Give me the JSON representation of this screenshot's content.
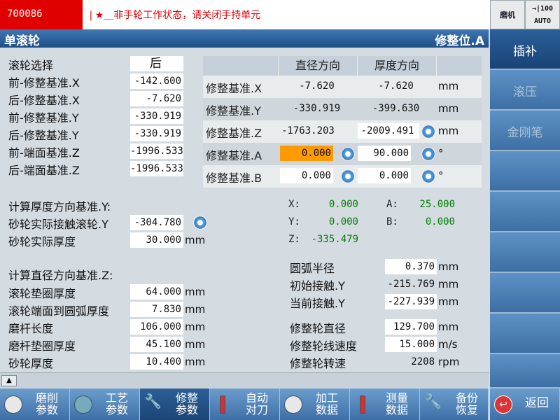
{
  "alarm": {
    "id": "700086",
    "message": "❘★＿非手轮工作状态，请关闭手持单元"
  },
  "mode": {
    "icon_text": "磨机",
    "feed": "→|100",
    "op_mode": "AUTO"
  },
  "title": {
    "left": "单滚轮",
    "right": "修整位.A"
  },
  "left_params": [
    {
      "label": "滚轮选择",
      "value": "后"
    },
    {
      "label": "前-修整基准.X",
      "value": "-142.600"
    },
    {
      "label": "后-修整基准.X",
      "value": "-7.620"
    },
    {
      "label": "前-修整基准.Y",
      "value": "-330.919"
    },
    {
      "label": "后-修整基准.Y",
      "value": "-330.919"
    },
    {
      "label": "前-端面基准.Z",
      "value": "-1996.533"
    },
    {
      "label": "后-端面基准.Z",
      "value": "-1996.533"
    }
  ],
  "table": {
    "headers": [
      "直径方向",
      "厚度方向"
    ],
    "rows": [
      {
        "label": "修整基准.X",
        "dia": "-7.620",
        "thk": "-7.620",
        "unit": "mm"
      },
      {
        "label": "修整基准.Y",
        "dia": "-330.919",
        "thk": "-399.630",
        "unit": "mm"
      },
      {
        "label": "修整基准.Z",
        "dia": "-1763.203",
        "thk": "-2009.491",
        "unit": "mm"
      },
      {
        "label": "修整基准.A",
        "dia": "0.000",
        "thk": "90.000",
        "unit": "°"
      },
      {
        "label": "修整基准.B",
        "dia": "0.000",
        "thk": "0.000",
        "unit": "°"
      }
    ]
  },
  "thickness_section": {
    "title": "计算厚度方向基准.Y:",
    "contact_label": "砂轮实际接触滚轮.Y",
    "contact_value": "-304.780",
    "thickness_label": "砂轮实际厚度",
    "thickness_value": "30.000",
    "unit": "mm"
  },
  "coords": {
    "x_label": "X:",
    "x": "0.000",
    "y_label": "Y:",
    "y": "0.000",
    "z_label": "Z:",
    "z": "-335.479",
    "a_label": "A:",
    "a": "25.000",
    "b_label": "B:",
    "b": "0.000"
  },
  "diameter_section": {
    "title": "计算直径方向基准.Z:",
    "items": [
      {
        "label": "滚轮垫圈厚度",
        "value": "64.000",
        "unit": "mm"
      },
      {
        "label": "滚轮端面到圆弧厚度",
        "value": "7.830",
        "unit": "mm"
      },
      {
        "label": "磨杆长度",
        "value": "106.000",
        "unit": "mm"
      },
      {
        "label": "磨杆垫圈厚度",
        "value": "45.100",
        "unit": "mm"
      },
      {
        "label": "砂轮厚度",
        "value": "10.400",
        "unit": "mm"
      }
    ]
  },
  "arc_section": [
    {
      "label": "圆弧半径",
      "value": "0.370",
      "unit": "mm"
    },
    {
      "label": "初始接触.Y",
      "value": "-215.769",
      "unit": "mm"
    },
    {
      "label": "当前接触.Y",
      "value": "-227.939",
      "unit": "mm"
    }
  ],
  "dresser_section": [
    {
      "label": "修整轮直径",
      "value": "129.700",
      "unit": "mm"
    },
    {
      "label": "修整轮线速度",
      "value": "15.000",
      "unit": "m/s"
    },
    {
      "label": "修整轮转速",
      "value": "2208",
      "unit": "rpm"
    }
  ],
  "right_softkeys": [
    "插补",
    "滚压",
    "金刚笔"
  ],
  "bottom_softkeys": [
    {
      "l1": "磨削",
      "l2": "参数"
    },
    {
      "l1": "工艺",
      "l2": "参数"
    },
    {
      "l1": "修整",
      "l2": "参数"
    },
    {
      "l1": "自动",
      "l2": "对刀"
    },
    {
      "l1": "加工",
      "l2": "数据"
    },
    {
      "l1": "测量",
      "l2": "数据"
    },
    {
      "l1": "备份",
      "l2": "恢复"
    },
    {
      "l1": "返回",
      "l2": ""
    }
  ],
  "colors": {
    "accent": "#2b5f99",
    "alarm": "#e00000",
    "highlight": "#ff9a00",
    "coord_value": "#008000"
  }
}
